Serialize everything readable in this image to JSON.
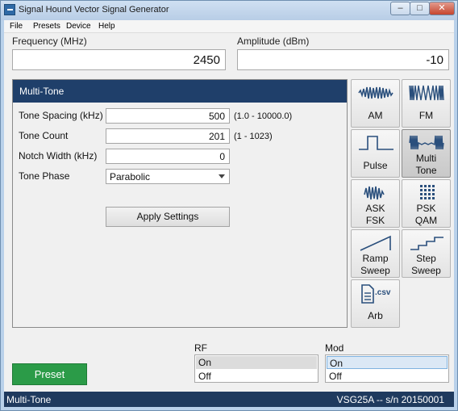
{
  "window": {
    "title": "Signal Hound Vector Signal Generator",
    "controls": {
      "minimize": "–",
      "maximize": "□",
      "close": "✕"
    }
  },
  "menu": [
    "File",
    "Presets",
    "Device",
    "Help"
  ],
  "frequency": {
    "label": "Frequency (MHz)",
    "value": "2450"
  },
  "amplitude": {
    "label": "Amplitude (dBm)",
    "value": "-10"
  },
  "panel": {
    "title": "Multi-Tone",
    "tone_spacing": {
      "label": "Tone Spacing (kHz)",
      "value": "500",
      "range": "(1.0 - 10000.0)"
    },
    "tone_count": {
      "label": "Tone Count",
      "value": "201",
      "range": "(1 - 1023)"
    },
    "notch_width": {
      "label": "Notch Width (kHz)",
      "value": "0"
    },
    "tone_phase": {
      "label": "Tone Phase",
      "value": "Parabolic"
    },
    "apply_label": "Apply Settings"
  },
  "modulations": [
    {
      "id": "am",
      "line1": "AM",
      "line2": "",
      "icon": "am-wave-icon",
      "active": false
    },
    {
      "id": "fm",
      "line1": "FM",
      "line2": "",
      "icon": "fm-wave-icon",
      "active": false
    },
    {
      "id": "pulse",
      "line1": "Pulse",
      "line2": "",
      "icon": "pulse-wave-icon",
      "active": false
    },
    {
      "id": "multi-tone",
      "line1": "Multi",
      "line2": "Tone",
      "icon": "multi-tone-icon",
      "active": true
    },
    {
      "id": "ask-fsk",
      "line1": "ASK",
      "line2": "FSK",
      "icon": "ask-wave-icon",
      "active": false
    },
    {
      "id": "psk-qam",
      "line1": "PSK",
      "line2": "QAM",
      "icon": "constellation-icon",
      "active": false
    },
    {
      "id": "ramp-sweep",
      "line1": "Ramp",
      "line2": "Sweep",
      "icon": "ramp-icon",
      "active": false
    },
    {
      "id": "step-sweep",
      "line1": "Step",
      "line2": "Sweep",
      "icon": "step-icon",
      "active": false
    },
    {
      "id": "arb",
      "line1": "Arb",
      "line2": "",
      "icon": "csv-file-icon",
      "icon_text": ".csv",
      "active": false
    }
  ],
  "rf": {
    "label": "RF",
    "options": [
      "On",
      "Off"
    ],
    "selected": "On"
  },
  "mod": {
    "label": "Mod",
    "options": [
      "On",
      "Off"
    ],
    "selected": "On"
  },
  "preset_label": "Preset",
  "status": {
    "mode": "Multi-Tone",
    "device": "VSG25A -- s/n 20150001"
  },
  "colors": {
    "header": "#1f3f6a",
    "status": "#1f3a5e",
    "preset": "#2b9b48"
  }
}
